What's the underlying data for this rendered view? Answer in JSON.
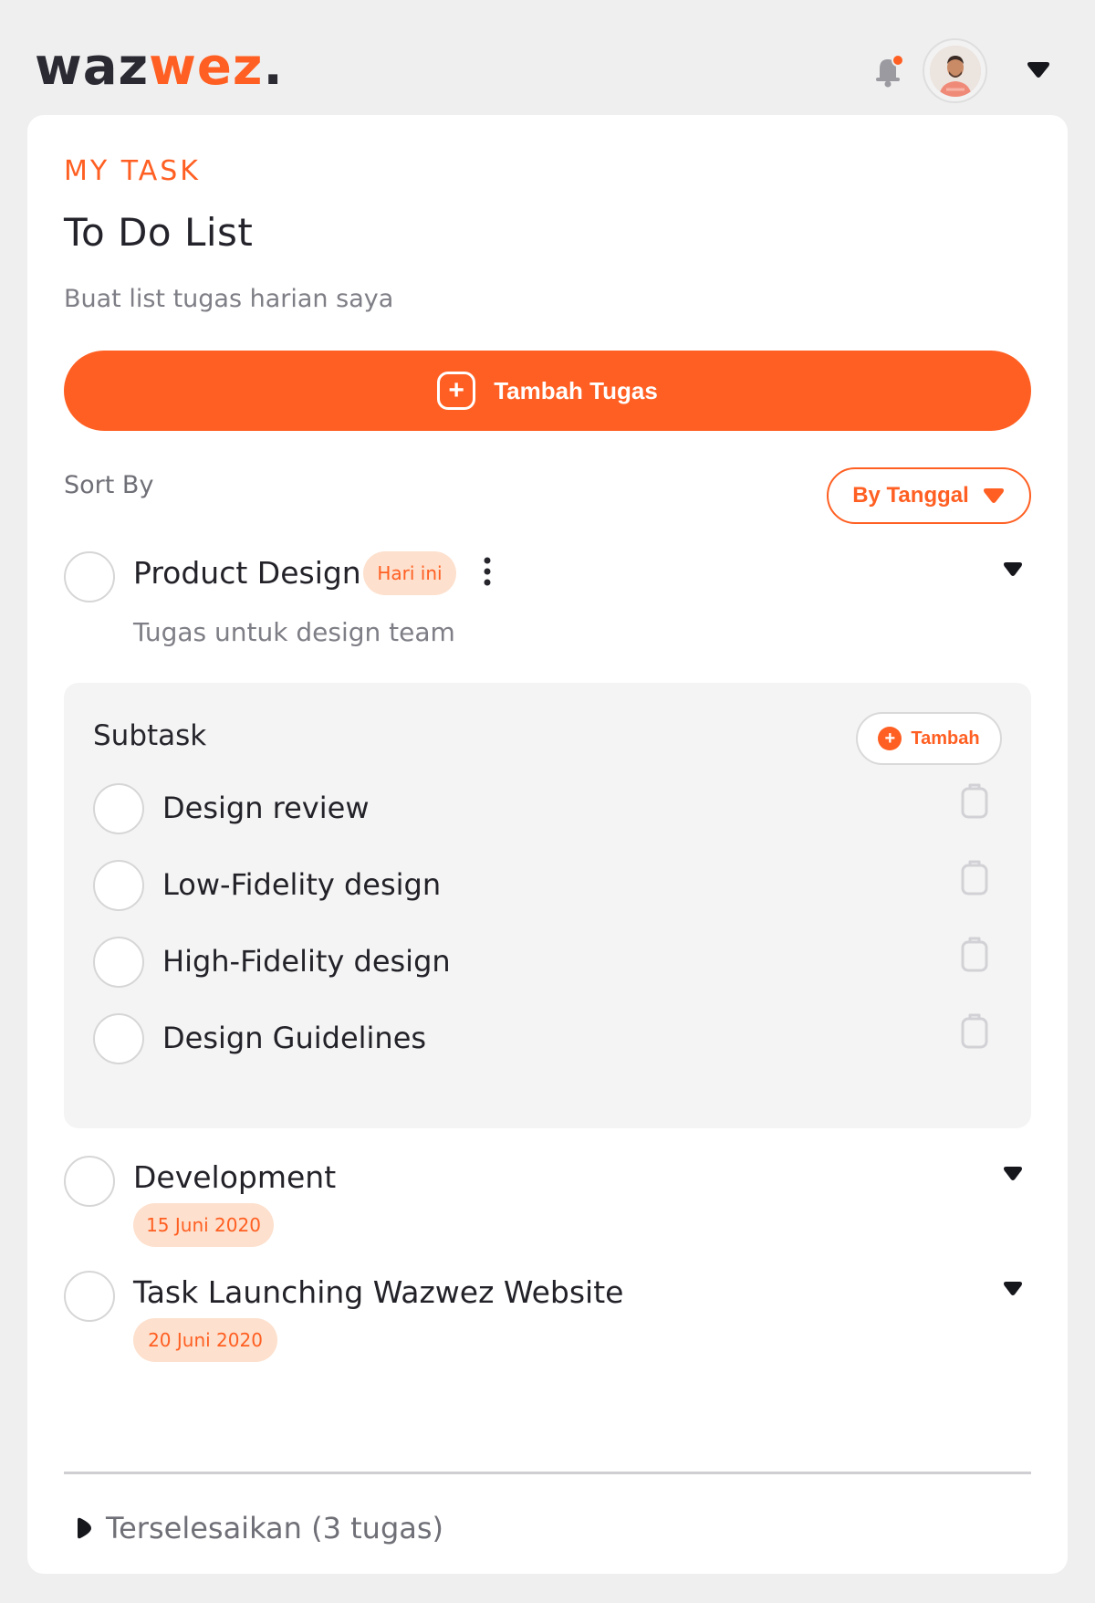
{
  "brand": {
    "logo_part1": "waz",
    "logo_part2": "wez",
    "logo_dot": ".",
    "accent_color": "#ff5f22"
  },
  "header": {
    "bell_icon": "bell-icon",
    "avatar_icon": "user-avatar",
    "menu_icon": "caret-down-icon"
  },
  "page": {
    "eyebrow": "MY TASK",
    "title": "To Do List",
    "subtitle": "Buat list tugas harian saya",
    "add_button_label": "Tambah Tugas",
    "sort_label": "Sort By",
    "sort_value": "By Tanggal"
  },
  "tasks": [
    {
      "title": "Product Design",
      "badge": "Hari ini",
      "description": "Tugas untuk design team",
      "subtask_heading": "Subtask",
      "subtask_add_label": "Tambah",
      "subtasks": [
        {
          "label": "Design review"
        },
        {
          "label": "Low-Fidelity design"
        },
        {
          "label": "High-Fidelity design"
        },
        {
          "label": "Design Guidelines"
        }
      ]
    },
    {
      "title": "Development",
      "date": "15 Juni 2020"
    },
    {
      "title": "Task Launching Wazwez Website",
      "date": "20 Juni 2020"
    }
  ],
  "completed": {
    "label": "Terselesaikan (3 tugas)"
  }
}
